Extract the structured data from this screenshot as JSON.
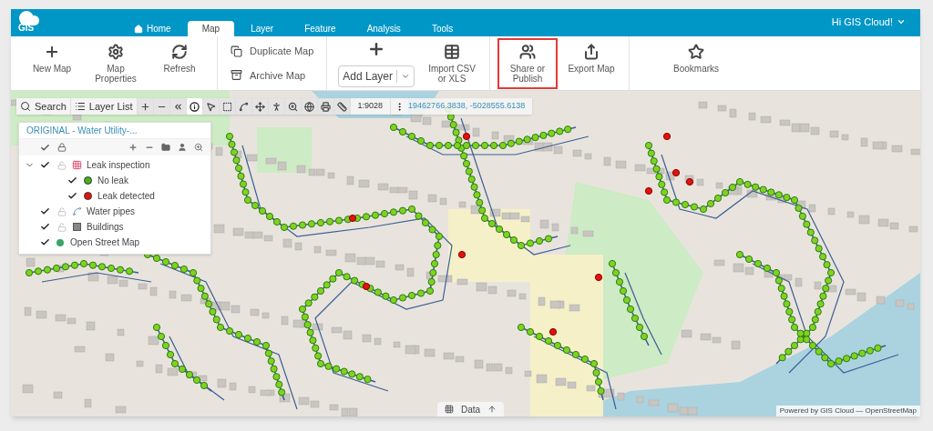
{
  "header": {
    "logo": "GIS",
    "tabs": [
      {
        "label": "Home",
        "selected": false
      },
      {
        "label": "Map",
        "selected": true
      },
      {
        "label": "Layer",
        "selected": false
      },
      {
        "label": "Feature",
        "selected": false
      },
      {
        "label": "Analysis",
        "selected": false
      },
      {
        "label": "Tools",
        "selected": false
      }
    ],
    "user_menu": "Hi GIS Cloud!"
  },
  "ribbon": {
    "groups": [
      {
        "items": [
          {
            "kind": "large",
            "label": "New Map",
            "highlighted": false
          },
          {
            "kind": "large",
            "label": "Map Properties",
            "highlighted": false
          },
          {
            "kind": "large",
            "label": "Refresh",
            "highlighted": false
          }
        ]
      },
      {
        "items": [
          {
            "kind": "small",
            "label": "Duplicate Map",
            "highlighted": false
          },
          {
            "kind": "small",
            "label": "Archive Map",
            "highlighted": false
          }
        ]
      },
      {
        "items": [
          {
            "kind": "dropdown",
            "label": "Add Layer",
            "highlighted": false
          },
          {
            "kind": "large",
            "label": "Import CSV or XLS",
            "highlighted": false
          }
        ]
      },
      {
        "items": [
          {
            "kind": "large",
            "label": "Share or Publish",
            "highlighted": true
          },
          {
            "kind": "large",
            "label": "Export Map",
            "highlighted": false
          }
        ]
      },
      {
        "items": [
          {
            "kind": "large",
            "label": "Bookmarks",
            "highlighted": false
          }
        ]
      }
    ]
  },
  "map_toolbar": {
    "search": "Search",
    "layer_list": "Layer List",
    "tools": [
      {
        "selected": false
      },
      {
        "selected": false
      },
      {
        "selected": false
      },
      {
        "selected": true
      },
      {
        "selected": false
      },
      {
        "selected": false
      },
      {
        "selected": false
      },
      {
        "selected": false
      },
      {
        "selected": false
      },
      {
        "selected": false
      },
      {
        "selected": false
      },
      {
        "selected": false
      },
      {
        "selected": false
      }
    ],
    "scale": "1:9028",
    "coordinates": "19462766.3838, -5028555.6138"
  },
  "layer_panel": {
    "title": "ORIGINAL - Water Utility-...",
    "layers": [
      {
        "kind": "group",
        "label": "Leak inspection",
        "checked": true,
        "locked": false,
        "expanded": true,
        "children": [
          {
            "kind": "point",
            "label": "No leak",
            "checked": true,
            "color": "#4caf1a"
          },
          {
            "kind": "point",
            "label": "Leak detected",
            "checked": true,
            "color": "#e3120b"
          }
        ]
      },
      {
        "kind": "line",
        "label": "Water pipes",
        "checked": true,
        "locked": false
      },
      {
        "kind": "polygon",
        "label": "Buildings",
        "checked": true,
        "locked": false
      },
      {
        "kind": "basemap",
        "label": "Open Street Map",
        "checked": true
      }
    ]
  },
  "data_tab": {
    "label": "Data"
  },
  "attribution": "Powered by GIS Cloud — OpenStreetMap"
}
